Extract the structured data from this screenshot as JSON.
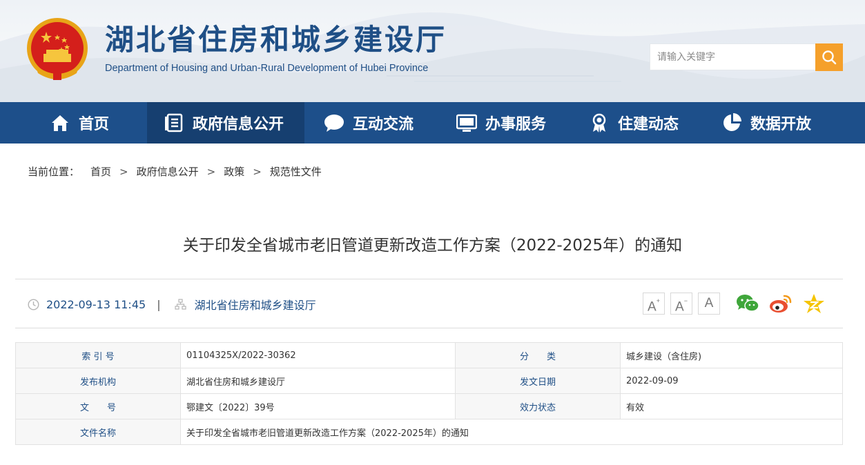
{
  "header": {
    "site_title": "湖北省住房和城乡建设厅",
    "site_subtitle": "Department of Housing and Urban-Rural Development of Hubei Province",
    "search_placeholder": "请输入关键字"
  },
  "nav": {
    "items": [
      {
        "label": "首页",
        "icon": "home-icon"
      },
      {
        "label": "政府信息公开",
        "icon": "document-list-icon",
        "active": true
      },
      {
        "label": "互动交流",
        "icon": "chat-bubble-icon"
      },
      {
        "label": "办事服务",
        "icon": "monitor-icon"
      },
      {
        "label": "住建动态",
        "icon": "award-ribbon-icon"
      },
      {
        "label": "数据开放",
        "icon": "pie-chart-icon"
      }
    ]
  },
  "breadcrumb": {
    "label": "当前位置：",
    "items": [
      "首页",
      "政府信息公开",
      "政策",
      "规范性文件"
    ],
    "separator": ">"
  },
  "article": {
    "title": "关于印发全省城市老旧管道更新改造工作方案（2022-2025年）的通知",
    "datetime": "2022-09-13 11:45",
    "divider": "|",
    "source": "湖北省住房和城乡建设厅"
  },
  "font_controls": {
    "increase": "A",
    "decrease": "A",
    "reset": "A"
  },
  "share": [
    "wechat-icon",
    "weibo-icon",
    "qzone-star-icon"
  ],
  "info_table": {
    "rows": [
      {
        "k1": "索 引 号",
        "v1": "01104325X/2022-30362",
        "k2": "分　　类",
        "v2": "城乡建设（含住房)"
      },
      {
        "k1": "发布机构",
        "v1": "湖北省住房和城乡建设厅",
        "k2": "发文日期",
        "v2": "2022-09-09"
      },
      {
        "k1": "文　　号",
        "v1": "鄂建文〔2022〕39号",
        "k2": "效力状态",
        "v2": "有效"
      },
      {
        "k1": "文件名称",
        "v1": "关于印发全省城市老旧管道更新改造工作方案（2022-2025年）的通知"
      }
    ]
  },
  "colors": {
    "nav_bg": "#1d4f8a",
    "nav_active_bg": "#163f70",
    "brand_blue": "#1f4f86",
    "search_button": "#f5a02b",
    "wechat_green": "#3fa63a",
    "weibo_orange": "#f39a1b",
    "qzone_yellow": "#f5c400"
  }
}
